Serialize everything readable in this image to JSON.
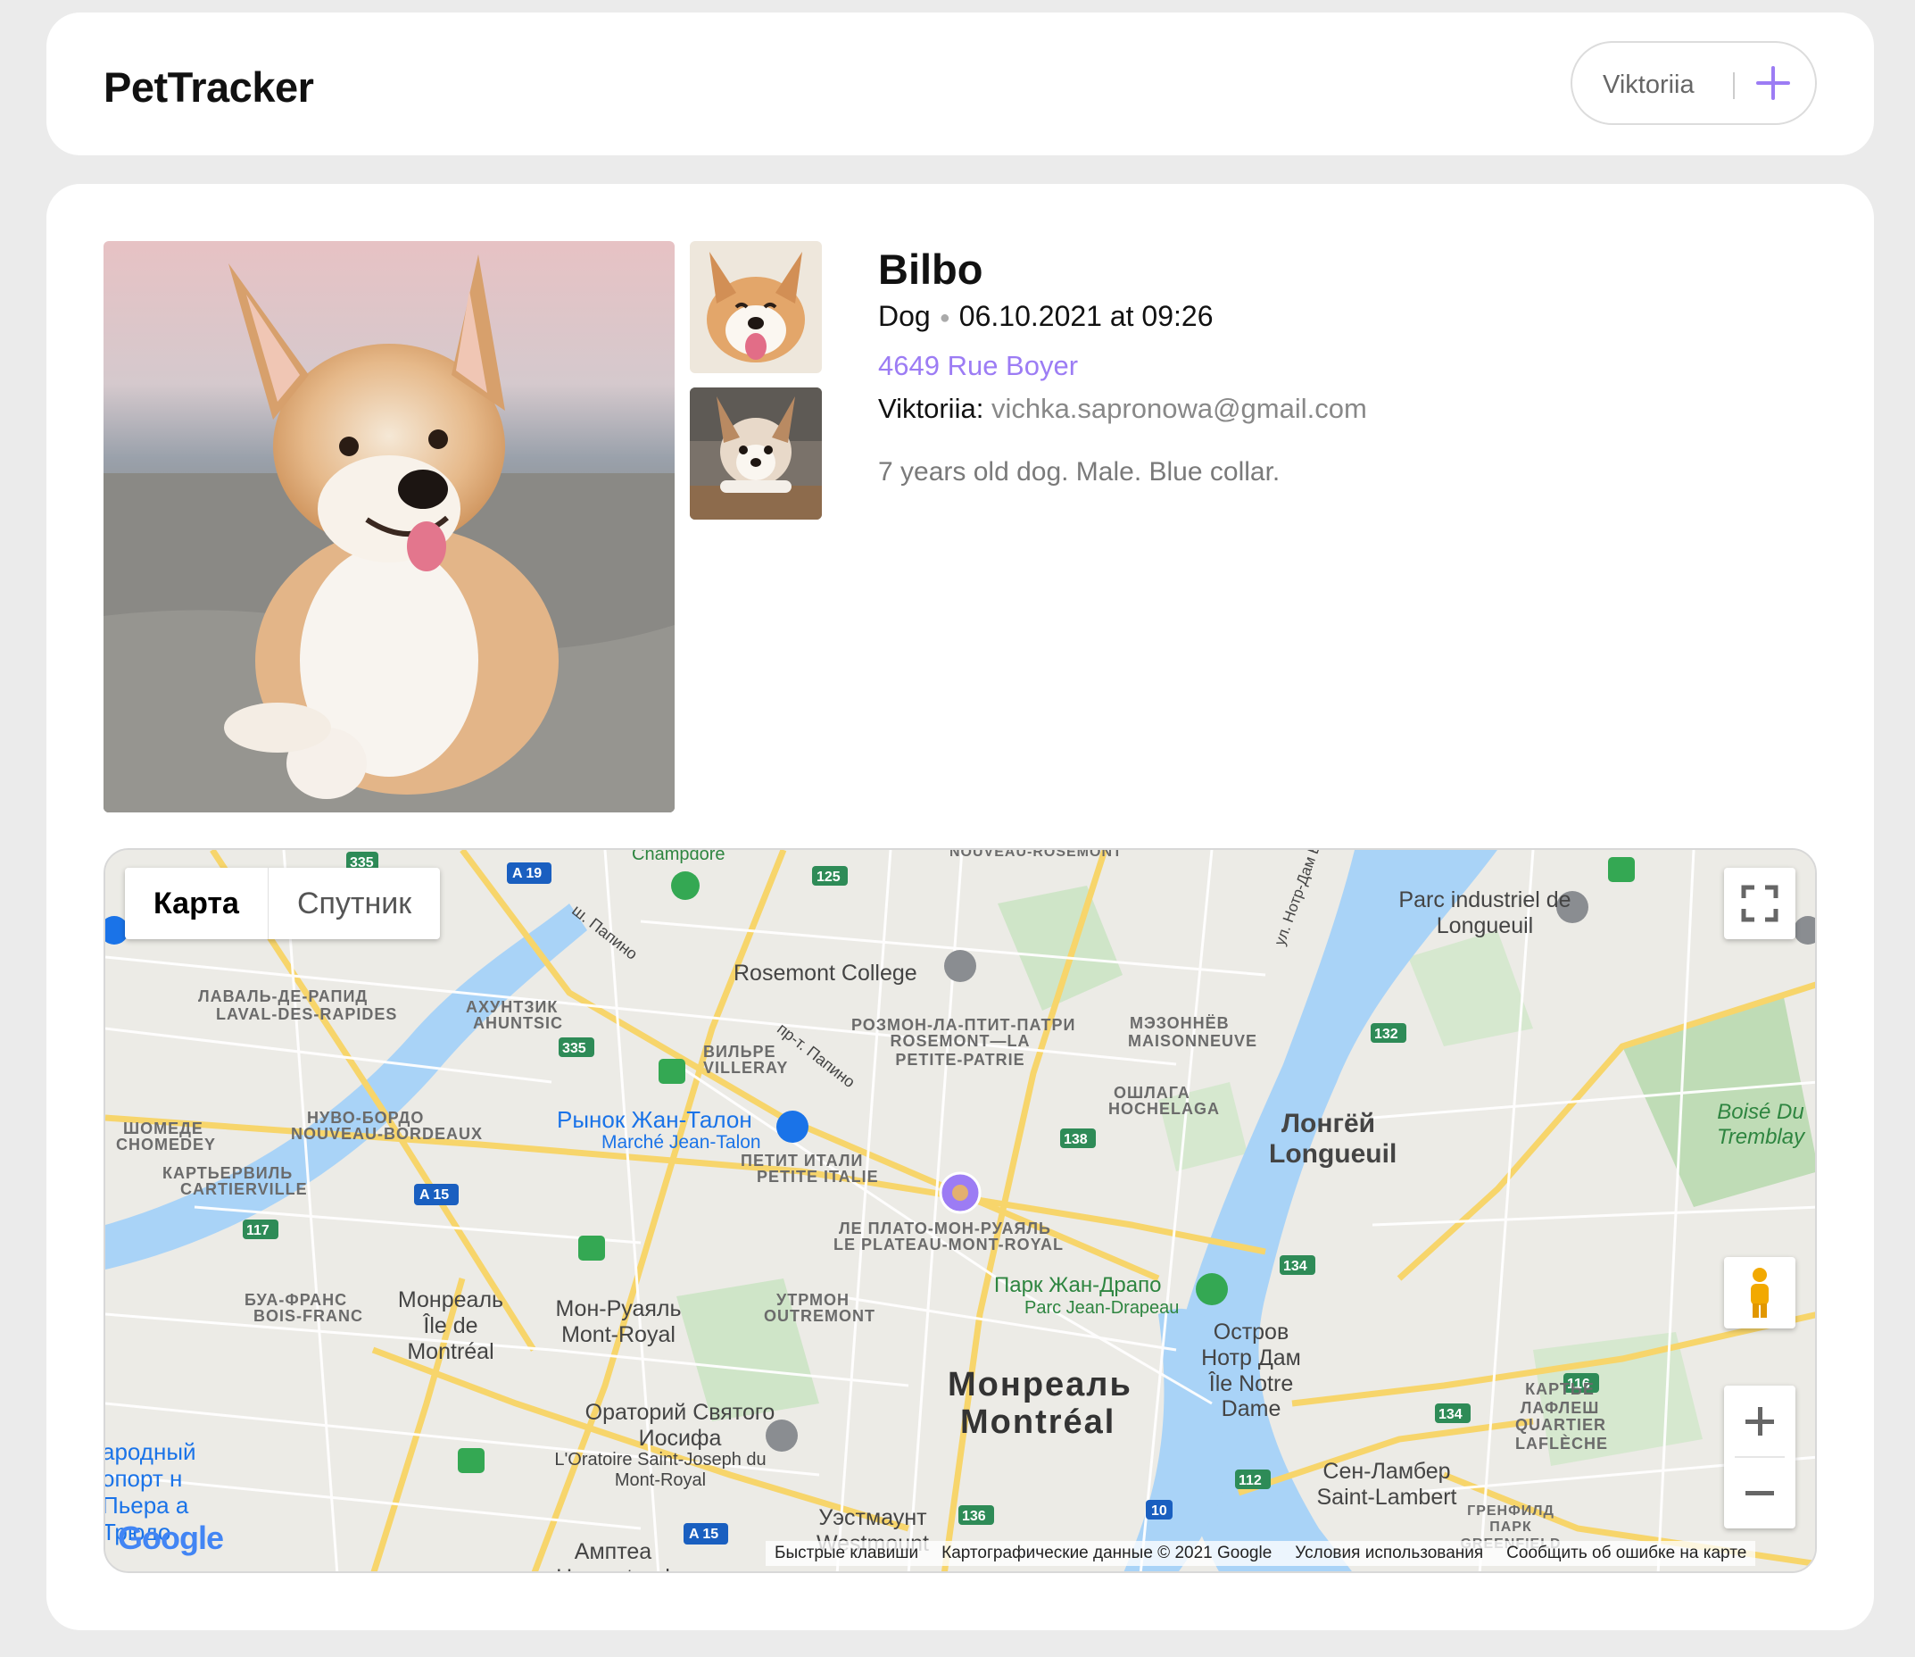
{
  "header": {
    "brand": "PetTracker",
    "user_name": "Viktoriia",
    "add_label": ""
  },
  "pet": {
    "name": "Bilbo",
    "species": "Dog",
    "datetime": "06.10.2021 at 09:26",
    "address": "4649 Rue Boyer",
    "owner_name": "Viktoriia:",
    "owner_email": "vichka.sapronowa@gmail.com",
    "description": "7 years old dog. Male. Blue collar."
  },
  "map": {
    "type_map": "Карта",
    "type_satellite": "Спутник",
    "labels": {
      "champdore": "Champdore",
      "nouveau_rosemont": "NOUVEAU-ROSEMONT",
      "papineau1": "ш. Папино",
      "rosemont_college": "Rosemont College",
      "parc_industriel": "Parc industriel de Longueuil",
      "laval_ru": "ЛАВАЛЬ-ДЕ-РАПИД",
      "laval_fr": "LAVAL-DES-RAPIDES",
      "ahuntsic_ru": "АХУНТЗИК",
      "ahuntsic_fr": "AHUNTSIC",
      "rosemont_ru": "РОЗМОН-ЛА-ПТИТ-ПАТРИ",
      "rosemont_fr": "ROSEMONT—LA PETITE-PATRIE",
      "maisonneuve_ru": "МЭЗОННЁВ",
      "maisonneuve_fr": "MAISONNEUVE",
      "villeray_ru": "ВИЛЬРЕ",
      "villeray_fr": "VILLERAY",
      "papineau2": "пр-т. Папино",
      "hochelaga_ru": "ОШЛАГА",
      "hochelaga_fr": "HOCHELAGA",
      "chomedey_ru": "ШОМЕДЕ",
      "chomedey_fr": "CHOMEDEY",
      "nouveau_bordeaux_ru": "НУВО-БОРДО",
      "nouveau_bordeaux_fr": "NOUVEAU-BORDEAUX",
      "market_ru": "Рынок Жан-Талон",
      "market_fr": "Marché Jean-Talon",
      "longueuil_ru": "Лонгёй",
      "longueuil_fr": "Longueuil",
      "boise_tremblay": "Boisé Du Tremblay",
      "cartierville_ru": "КАРТЬЕРВИЛЬ",
      "cartierville_fr": "CARTIERVILLE",
      "petite_italie_ru": "ПЕТИТ ИТАЛИ",
      "petite_italie_fr": "PETITE ITALIE",
      "plateau_ru": "ЛЕ ПЛАТО-МОН-РУАЯЛЬ",
      "plateau_fr": "LE PLATEAU-MONT-ROYAL",
      "parc_jd_ru": "Парк Жан-Драпо",
      "parc_jd_fr": "Parc Jean-Drapeau",
      "bois_franc_ru": "БУА-ФРАНС",
      "bois_franc_fr": "BOIS-FRANC",
      "ile_montreal": "Монреаль Île de Montréal",
      "mont_royal": "Мон-Руаяль Mont-Royal",
      "outremont_ru": "УТРМОН",
      "outremont_fr": "OUTREMONT",
      "ile_notre_dame": "Остров Нотр Дам Île Notre Dame",
      "montreal_ru": "Монреаль",
      "montreal_fr": "Montréal",
      "oratoire": "Ораторий Святого Иосифа",
      "oratoire_fr": "L'Oratoire Saint-Joseph du Mont-Royal",
      "lafleche_ru": "КАРТЬЕ ЛАФЛЕШ",
      "lafleche_fr": "QUARTIER LAFLÈCHE",
      "saint_lambert": "Сен-Ламбер Saint-Lambert",
      "airport": "ародный опорт н Пьера а Трюдо",
      "westmount": "Уэстмаунт Westmount",
      "hampstead": "Амптеа Hampstead",
      "greenfield": "ГРЕНФИЛД ПАРК GREENFIELD",
      "notre_dame_st": "ул. Нотр-Дам В"
    },
    "road_shields": [
      "335",
      "A 19",
      "125",
      "132",
      "335",
      "138",
      "A 15",
      "117",
      "134",
      "116",
      "134",
      "112",
      "10",
      "136",
      "A 15"
    ],
    "footer": {
      "shortcuts": "Быстрые клавиши",
      "map_data": "Картографические данные © 2021 Google",
      "terms": "Условия использования",
      "report": "Сообщить об ошибке на карте"
    },
    "google": "Google"
  }
}
